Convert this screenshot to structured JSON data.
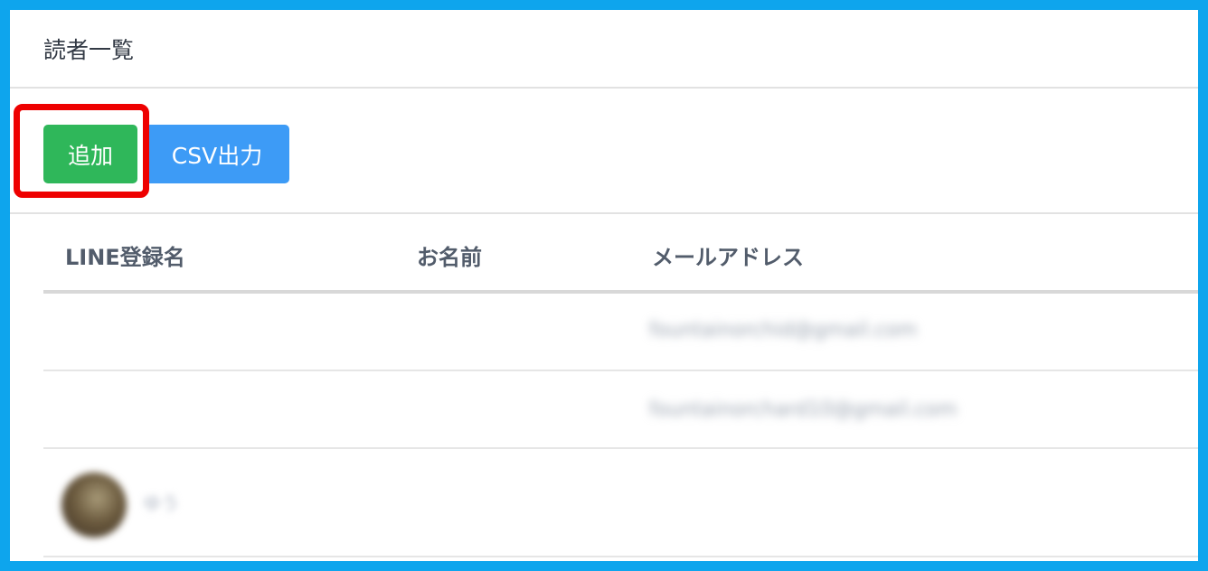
{
  "page": {
    "title": "読者一覧"
  },
  "toolbar": {
    "add_label": "追加",
    "csv_label": "CSV出力"
  },
  "table": {
    "columns": [
      "LINE登録名",
      "お名前",
      "メールアドレス"
    ],
    "rows": [
      {
        "line_name": "",
        "name": "",
        "email": "fountainorchid@gmail.com"
      },
      {
        "line_name": "",
        "name": "",
        "email": "fountainorchard10@gmail.com"
      },
      {
        "line_name": "ゆう",
        "name": "",
        "email": "",
        "avatar": "user-avatar"
      }
    ]
  },
  "colors": {
    "frame": "#0ea5ed",
    "add_button": "#2fb75a",
    "csv_button": "#3d9bf6",
    "highlight": "#ee0000",
    "header_text": "#525c6b"
  }
}
